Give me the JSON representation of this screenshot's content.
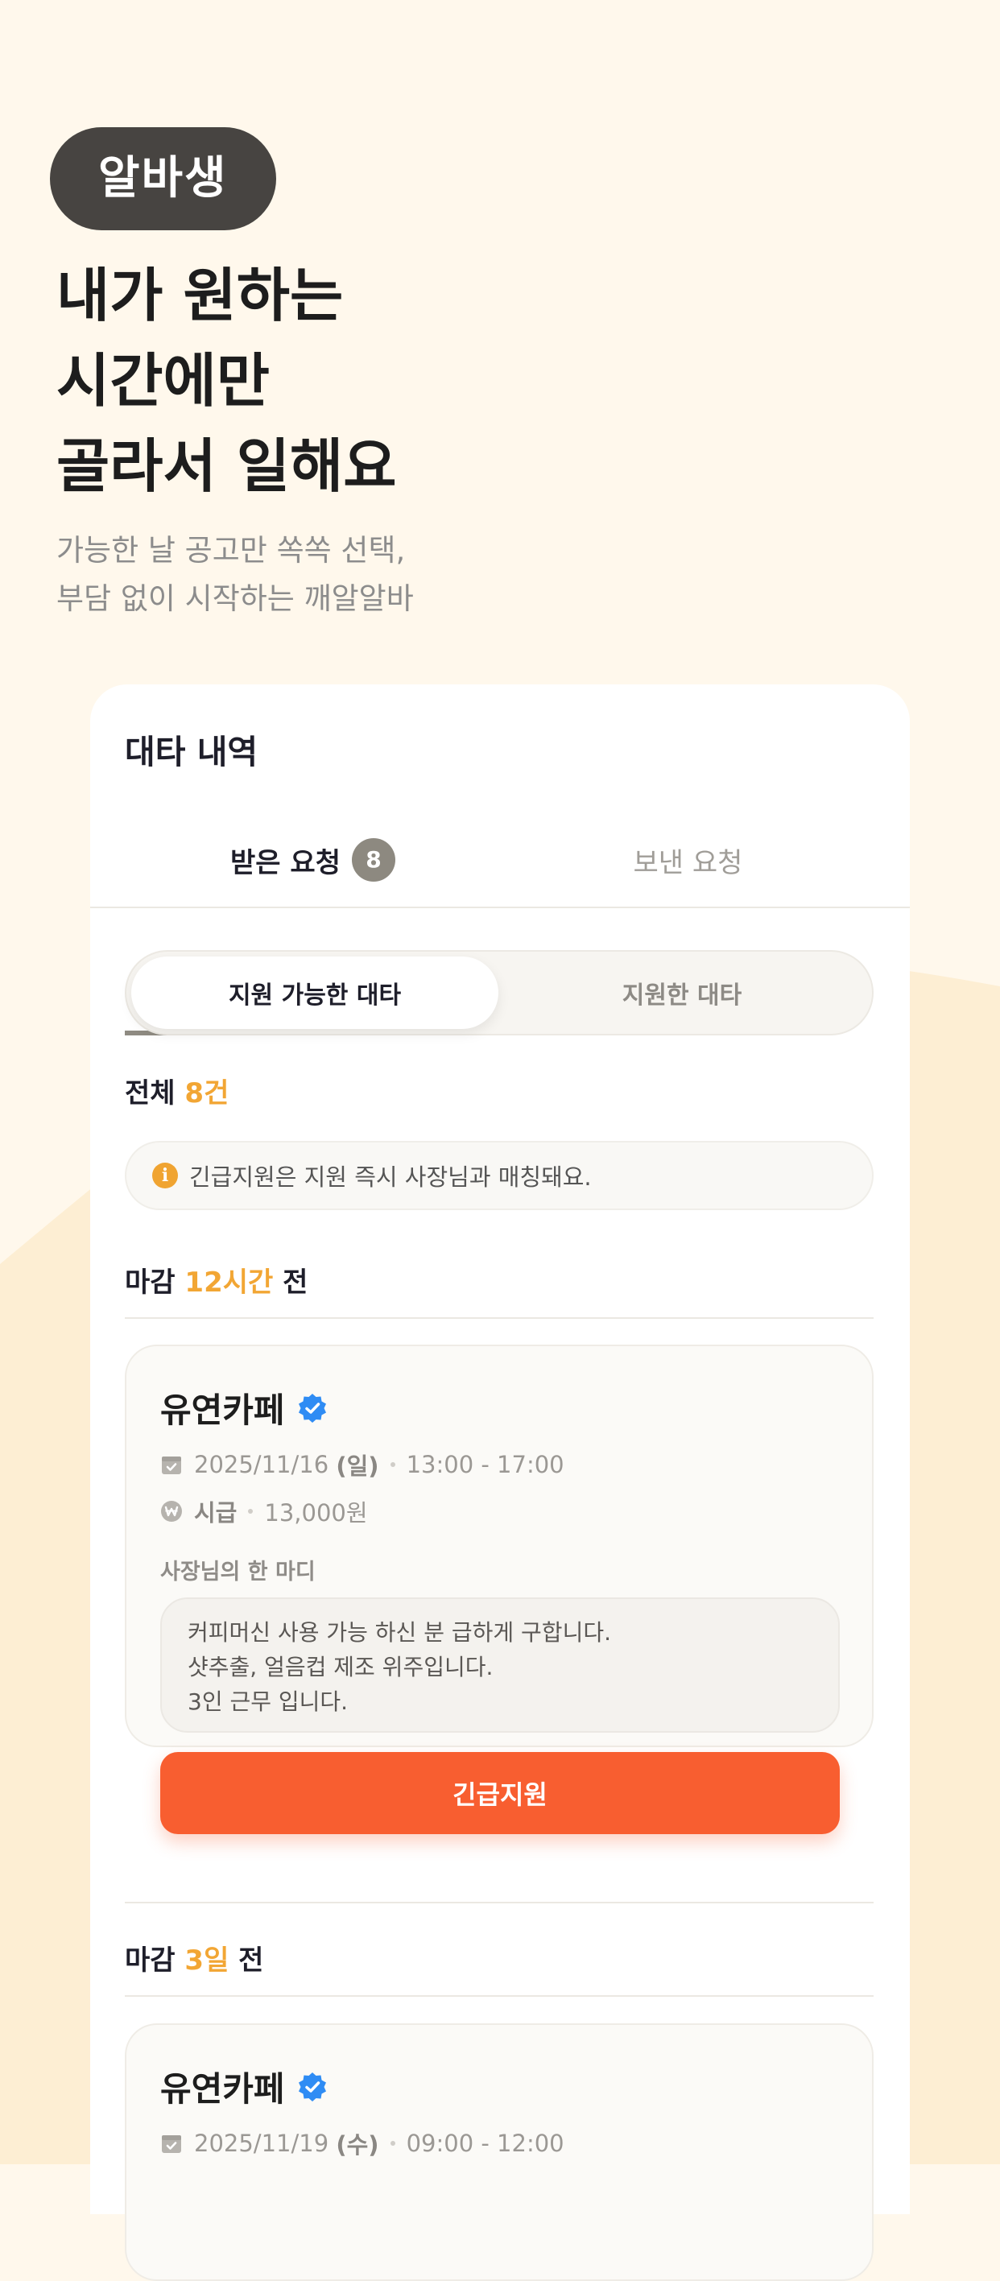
{
  "hero": {
    "badge": "알바생",
    "headline": [
      "내가 원하는",
      "시간에만",
      "골라서 일해요"
    ],
    "subtitle": [
      "가능한 날 공고만 쏙쏙 선택,",
      "부담 없이 시작하는 깨알알바"
    ]
  },
  "card": {
    "title": "대타 내역",
    "tabs": [
      {
        "label": "받은 요청",
        "count": "8",
        "active": true
      },
      {
        "label": "보낸 요청",
        "active": false
      }
    ],
    "segments": [
      {
        "label": "지원 가능한 대타",
        "active": true
      },
      {
        "label": "지원한 대타",
        "active": false
      }
    ],
    "total": {
      "prefix": "전체 ",
      "count": "8건"
    },
    "notice": "긴급지원은 지원 즉시 사장님과 매칭돼요."
  },
  "groups": [
    {
      "deadline_prefix": "마감 ",
      "deadline_value": "12시간",
      "deadline_suffix": " 전",
      "job": {
        "name": "유연카페",
        "date": "2025/11/16",
        "weekday": "(일)",
        "time": "13:00 - 17:00",
        "wage_label": "시급",
        "wage": "13,000원",
        "owner_label": "사장님의 한 마디",
        "owner_message": [
          "커피머신 사용 가능 하신 분 급하게 구합니다.",
          "샷추출, 얼음컵 제조 위주입니다.",
          "3인 근무 입니다."
        ],
        "cta": "긴급지원"
      }
    },
    {
      "deadline_prefix": "마감 ",
      "deadline_value": "3일",
      "deadline_suffix": " 전",
      "job": {
        "name": "유연카페",
        "date": "2025/11/19",
        "weekday": "(수)",
        "time": "09:00 - 12:00"
      }
    }
  ],
  "colors": {
    "background": "#fff8ec",
    "accent_orange": "#f85e30",
    "highlight_yellow": "#f2a634",
    "verified_blue": "#2f8cf4",
    "badge_dark": "#474441"
  },
  "icons": [
    "verified-badge-icon",
    "calendar-icon",
    "won-coin-icon",
    "info-icon"
  ]
}
